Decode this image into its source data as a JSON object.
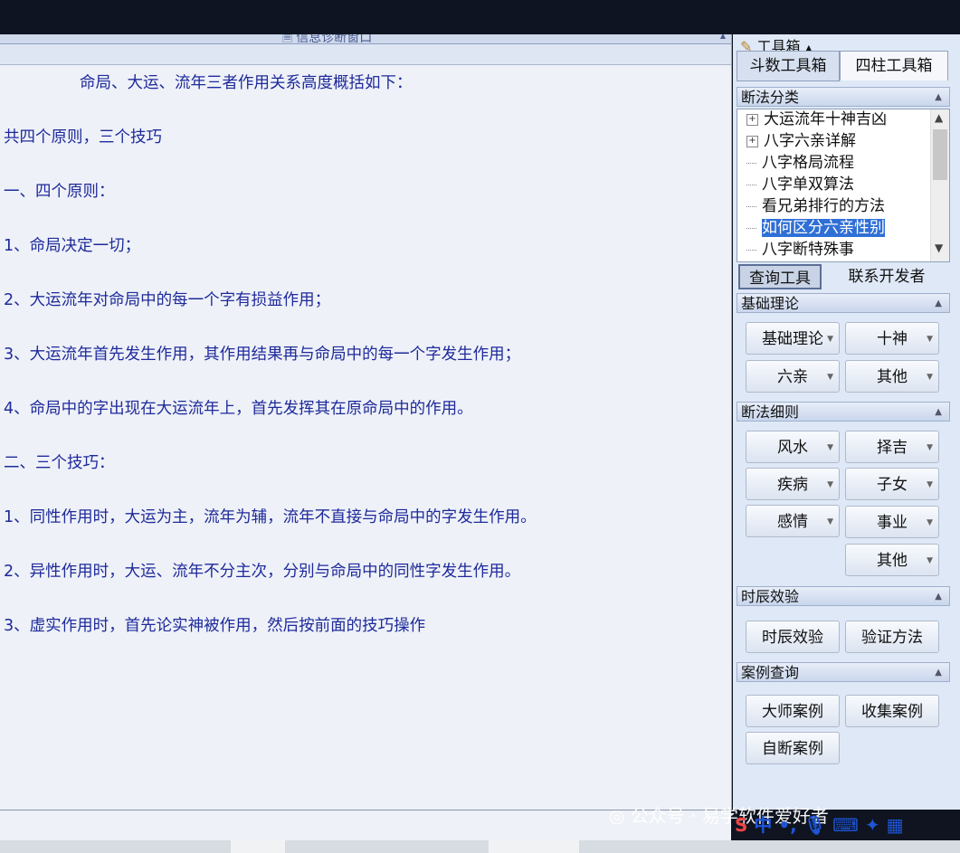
{
  "content_window": {
    "title": "信息诊断窗口",
    "lines": [
      "命局、大运、流年三者作用关系高度概括如下：",
      "共四个原则，三个技巧",
      "一、四个原则：",
      "1、命局决定一切；",
      "2、大运流年对命局中的每一个字有损益作用；",
      "3、大运流年首先发生作用，其作用结果再与命局中的每一个字发生作用；",
      "4、命局中的字出现在大运流年上，首先发挥其在原命局中的作用。",
      "二、三个技巧：",
      "1、同性作用时，大运为主，流年为辅，流年不直接与命局中的字发生作用。",
      "2、异性作用时，大运、流年不分主次，分别与命局中的同性字发生作用。",
      "3、虚实作用时，首先论实神被作用，然后按前面的技巧操作"
    ]
  },
  "toolbox": {
    "title": "工具箱",
    "tabs": [
      "斗数工具箱",
      "四柱工具箱"
    ],
    "sections": {
      "classification": {
        "header": "断法分类",
        "items": [
          "大运流年十神吉凶",
          "八字六亲详解",
          "八字格局流程",
          "八字单双算法",
          "看兄弟排行的方法",
          "如何区分六亲性别",
          "八字断特殊事"
        ]
      },
      "subtabs": [
        "查询工具",
        "联系开发者"
      ],
      "basic_theory": {
        "header": "基础理论",
        "buttons": [
          "基础理论",
          "十神",
          "六亲",
          "其他"
        ]
      },
      "rules": {
        "header": "断法细则",
        "buttons": [
          "风水",
          "择吉",
          "疾病",
          "子女",
          "感情",
          "事业",
          "其他"
        ]
      },
      "timing": {
        "header": "时辰效验",
        "buttons": [
          "时辰效验",
          "验证方法"
        ]
      },
      "cases": {
        "header": "案例查询",
        "buttons": [
          "大师案例",
          "收集案例",
          "自断案例"
        ]
      }
    }
  },
  "watermark": {
    "text": "公众号 · 易学软件爱好者"
  },
  "ime": {
    "label": "中"
  },
  "colors": {
    "content_text": "#1e2a9a",
    "selection": "#2f6fd6",
    "panel_bg": "#dfe8f6"
  }
}
